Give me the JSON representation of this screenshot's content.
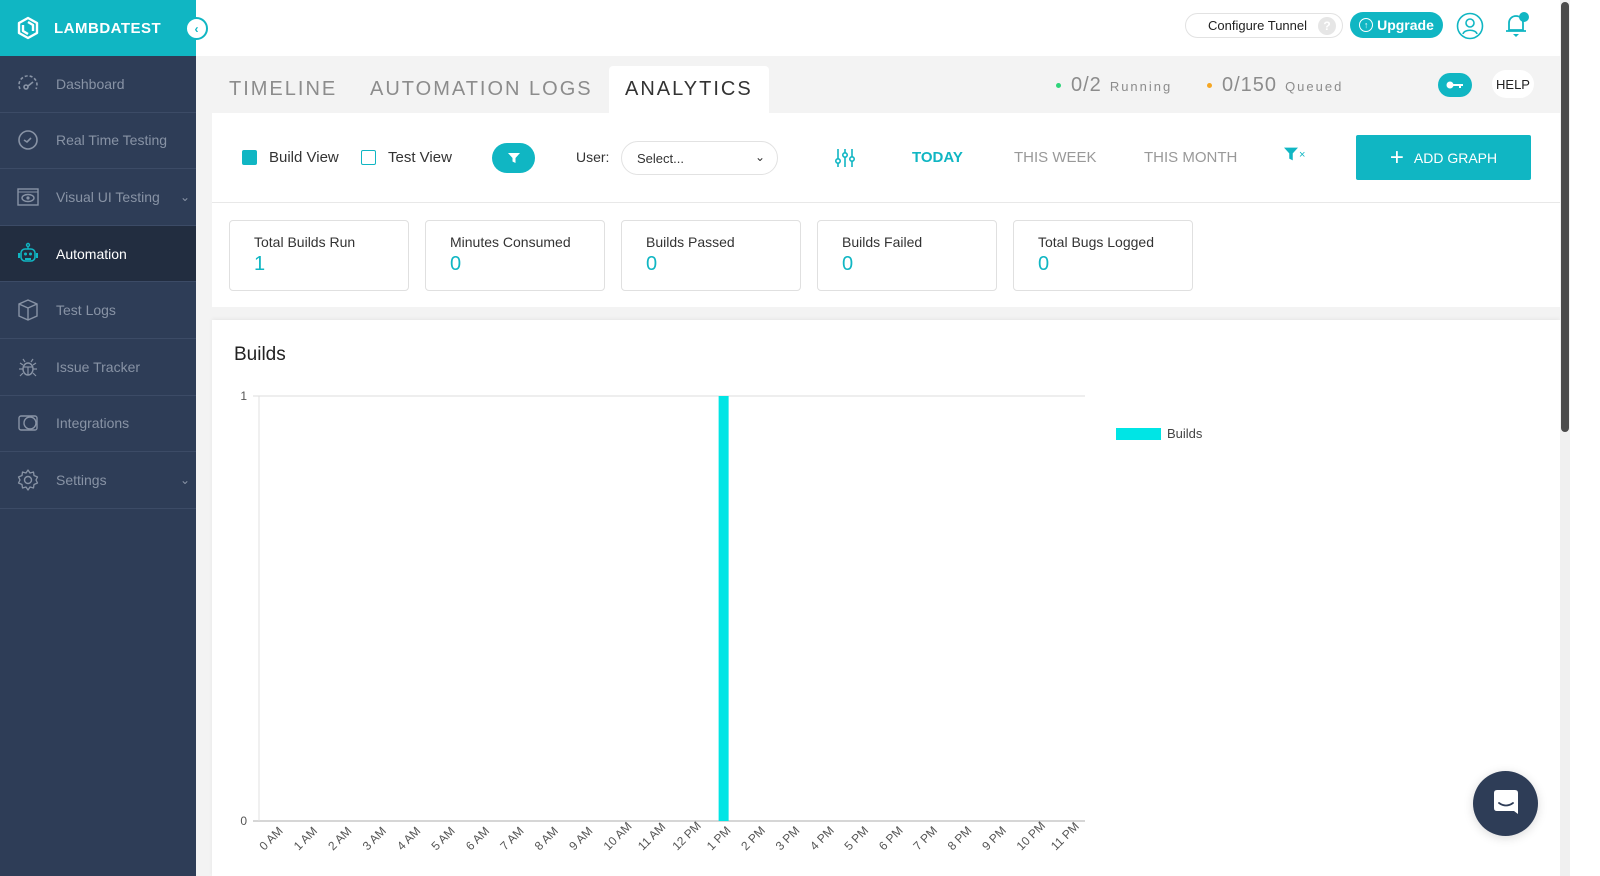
{
  "brand": {
    "name": "LAMBDATEST",
    "accent": "#10b6c3"
  },
  "sidebar": {
    "items": [
      {
        "label": "Dashboard",
        "icon": "dashboard-gauge-icon",
        "active": false,
        "expandable": false
      },
      {
        "label": "Real Time Testing",
        "icon": "clock-icon",
        "active": false,
        "expandable": false
      },
      {
        "label": "Visual UI Testing",
        "icon": "eye-window-icon",
        "active": false,
        "expandable": true
      },
      {
        "label": "Automation",
        "icon": "robot-icon",
        "active": true,
        "expandable": false
      },
      {
        "label": "Test Logs",
        "icon": "box-icon",
        "active": false,
        "expandable": false
      },
      {
        "label": "Issue Tracker",
        "icon": "bug-icon",
        "active": false,
        "expandable": false
      },
      {
        "label": "Integrations",
        "icon": "integrations-icon",
        "active": false,
        "expandable": false
      },
      {
        "label": "Settings",
        "icon": "gear-icon",
        "active": false,
        "expandable": true
      }
    ]
  },
  "topbar": {
    "configure_tunnel": "Configure Tunnel",
    "help_q": "?",
    "upgrade": "Upgrade"
  },
  "tabs": [
    {
      "label": "TIMELINE",
      "active": false
    },
    {
      "label": "AUTOMATION LOGS",
      "active": false
    },
    {
      "label": "ANALYTICS",
      "active": true
    }
  ],
  "status": {
    "running": {
      "value": "0/2",
      "label": "Running",
      "color": "#2ed47a"
    },
    "queued": {
      "value": "0/150",
      "label": "Queued",
      "color": "#f5a623"
    }
  },
  "help_label": "HELP",
  "controls": {
    "build_view": {
      "label": "Build View",
      "checked": true
    },
    "test_view": {
      "label": "Test View",
      "checked": false
    },
    "user_label": "User:",
    "user_select": "Select...",
    "ranges": [
      {
        "label": "TODAY",
        "active": true
      },
      {
        "label": "THIS WEEK",
        "active": false
      },
      {
        "label": "THIS MONTH",
        "active": false
      }
    ],
    "clear_filter_x": "×",
    "add_graph": "ADD GRAPH"
  },
  "stats": [
    {
      "label": "Total Builds Run",
      "value": "1"
    },
    {
      "label": "Minutes Consumed",
      "value": "0"
    },
    {
      "label": "Builds Passed",
      "value": "0"
    },
    {
      "label": "Builds Failed",
      "value": "0"
    },
    {
      "label": "Total Bugs Logged",
      "value": "0"
    }
  ],
  "chart_data": {
    "type": "bar",
    "title": "Builds",
    "categories": [
      "0 AM",
      "1 AM",
      "2 AM",
      "3 AM",
      "4 AM",
      "5 AM",
      "6 AM",
      "7 AM",
      "8 AM",
      "9 AM",
      "10 AM",
      "11 AM",
      "12 PM",
      "1 PM",
      "2 PM",
      "3 PM",
      "4 PM",
      "5 PM",
      "6 PM",
      "7 PM",
      "8 PM",
      "9 PM",
      "10 PM",
      "11 PM"
    ],
    "series": [
      {
        "name": "Builds",
        "color": "#00e5e5",
        "values": [
          0,
          0,
          0,
          0,
          0,
          0,
          0,
          0,
          0,
          0,
          0,
          0,
          0,
          1,
          0,
          0,
          0,
          0,
          0,
          0,
          0,
          0,
          0,
          0
        ]
      }
    ],
    "yticks": [
      "0",
      "1"
    ],
    "ylim": [
      0,
      1
    ],
    "xlabel": "",
    "ylabel": "",
    "legend": "right",
    "grid": true
  }
}
